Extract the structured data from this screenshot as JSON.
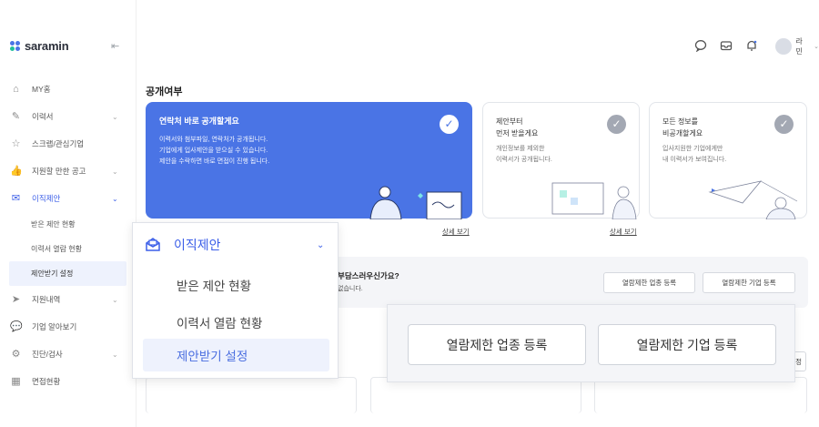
{
  "brand": {
    "name": "saramin"
  },
  "header": {
    "user_name": "라민"
  },
  "sidebar": {
    "items": [
      {
        "label": "MY홈"
      },
      {
        "label": "이력서"
      },
      {
        "label": "스크랩/관심기업"
      },
      {
        "label": "지원할 만한 공고"
      },
      {
        "label": "이직제안"
      },
      {
        "label": "지원내역"
      },
      {
        "label": "기업 알아보기"
      },
      {
        "label": "진단/검사"
      },
      {
        "label": "면접현황"
      }
    ],
    "sub_items": [
      {
        "label": "받은 제안 현황"
      },
      {
        "label": "이력서 열람 현황"
      },
      {
        "label": "제안받기 설정"
      }
    ]
  },
  "main": {
    "section_title": "공개여부",
    "cards": [
      {
        "title": "연락처 바로 공개할게요",
        "desc": "이력서와 첨부파일, 연락처가 공개됩니다.\n기업에게 입사제안을 받으실 수 있습니다.\n제안을 수락하면 바로 면접이 진행 됩니다."
      },
      {
        "title": "제안부터\n먼저 받을게요",
        "desc": "개인정보를 제외한\n이력서가 공개됩니다."
      },
      {
        "title": "모든 정보를\n비공개할게요",
        "desc": "입사지원한 기업에게만\n내 이력서가 보여집니다."
      }
    ],
    "detail_link": "상세 보기",
    "restriction": {
      "question": "부담스러우신가요?",
      "sub": "없습니다.",
      "industry_button": "열람제한 업종 등록",
      "company_button": "열람제한 기업 등록"
    },
    "partial_tab": "정"
  },
  "zoom_menu": {
    "title": "이직제안",
    "items": [
      "받은 제안 현황",
      "이력서 열람 현황",
      "제안받기 설정"
    ]
  },
  "zoom_buttons": {
    "industry_button": "열람제한 업종 등록",
    "company_button": "열람제한 기업 등록"
  },
  "colors": {
    "accent": "#4a74e5",
    "nav_active": "#3b5ee8",
    "sub_active_bg": "#eef2fd"
  }
}
